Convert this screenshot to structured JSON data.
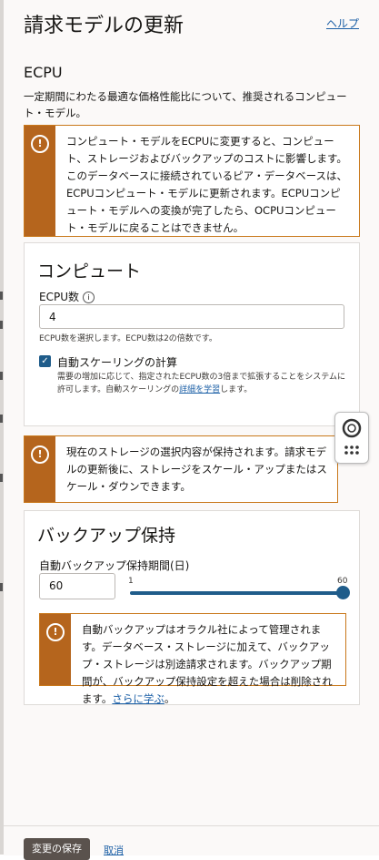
{
  "header": {
    "title": "請求モデルの更新",
    "help_label": "ヘルプ"
  },
  "ecpu_section": {
    "heading": "ECPU",
    "description": "一定期間にわたる最適な価格性能比について、推奨されるコンピュート・モデル。"
  },
  "warning_model": {
    "text": "コンピュート・モデルをECPUに変更すると、コンピュート、ストレージおよびバックアップのコストに影響します。このデータベースに接続されているピア・データベースは、ECPUコンピュート・モデルに更新されます。ECPUコンピュート・モデルへの変換が完了したら、OCPUコンピュート・モデルに戻ることはできません。"
  },
  "compute_card": {
    "title": "コンピュート",
    "ecpu_label": "ECPU数",
    "ecpu_value": "4",
    "ecpu_hint": "ECPU数を選択します。ECPU数は2の倍数です。",
    "autoscale_label": "自動スケーリングの計算",
    "autoscale_checked": true,
    "autoscale_hint_before": "需要の増加に応じて、指定されたECPU数の3倍まで拡張することをシステムに許可します。自動スケーリングの",
    "autoscale_hint_link": "詳細を学習",
    "autoscale_hint_after": "します。"
  },
  "warning_storage": {
    "text": "現在のストレージの選択内容が保持されます。請求モデルの更新後に、ストレージをスケール・アップまたはスケール・ダウンできます。"
  },
  "backup_card": {
    "title": "バックアップ保持",
    "period_label": "自動バックアップ保持期間(日)",
    "period_value": "60",
    "slider_min": "1",
    "slider_max": "60",
    "slider_level": 1.0,
    "note_text": "自動バックアップはオラクル社によって管理されます。データベース・ストレージに加えて、バックアップ・ストレージは別途請求されます。バックアップ期間が、バックアップ保持設定を超えた場合は削除されます。",
    "note_link": "さらに学ぶ",
    "note_end": "。"
  },
  "footer": {
    "save_label": "変更の保存",
    "cancel_label": "取消"
  },
  "colors": {
    "accent": "#1f5c8a",
    "warning": "#b5651d",
    "link": "#1b5fa6",
    "save_button": "#5a524d"
  },
  "icons": [
    "warning-icon",
    "info-icon",
    "check-icon",
    "lifebuoy-icon",
    "grid-dots-icon"
  ]
}
